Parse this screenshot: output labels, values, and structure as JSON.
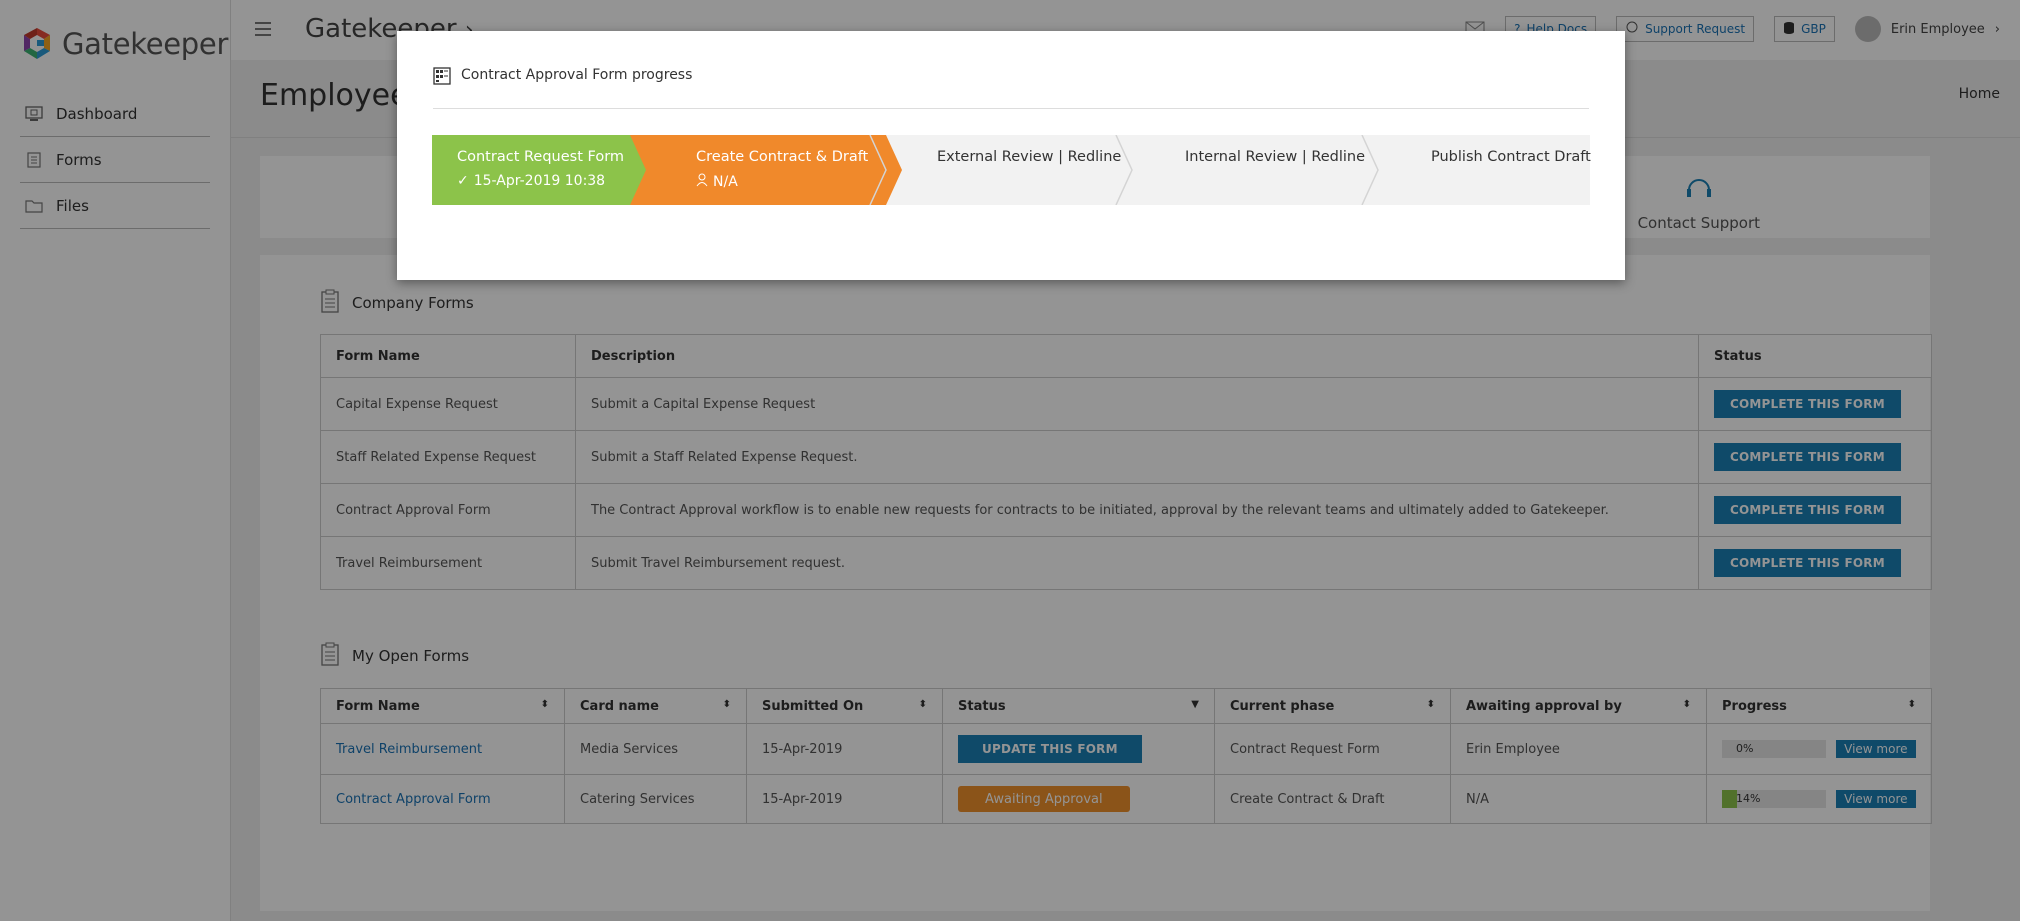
{
  "app": {
    "logo_text": "Gatekeeper",
    "title": "Gatekeeper",
    "title_chevron": "›"
  },
  "sidebar": {
    "items": [
      {
        "label": "Dashboard",
        "icon": "dashboard-icon"
      },
      {
        "label": "Forms",
        "icon": "forms-icon"
      },
      {
        "label": "Files",
        "icon": "folder-icon"
      }
    ]
  },
  "topbar": {
    "help_docs": "Help Docs",
    "support_request": "Support Request",
    "currency": "GBP",
    "user_name": "Erin Employee",
    "user_chevron": "›"
  },
  "page": {
    "title": "Employee",
    "breadcrumb_home": "Home",
    "contact_support": "Contact Support"
  },
  "company_forms": {
    "heading": "Company Forms",
    "columns": [
      "Form Name",
      "Description",
      "Status"
    ],
    "rows": [
      {
        "name": "Capital Expense Request",
        "description": "Submit a Capital Expense Request",
        "action": "COMPLETE THIS FORM"
      },
      {
        "name": "Staff Related Expense Request",
        "description": "Submit a Staff Related Expense Request.",
        "action": "COMPLETE THIS FORM"
      },
      {
        "name": "Contract Approval Form",
        "description": "The Contract Approval workflow is to enable new requests for contracts to be initiated, approval by the relevant teams and ultimately added to Gatekeeper.",
        "action": "COMPLETE THIS FORM"
      },
      {
        "name": "Travel Reimbursement",
        "description": "Submit Travel Reimbursement request.",
        "action": "COMPLETE THIS FORM"
      }
    ]
  },
  "open_forms": {
    "heading": "My Open Forms",
    "columns": [
      "Form Name",
      "Card name",
      "Submitted On",
      "Status",
      "Current phase",
      "Awaiting approval by",
      "Progress"
    ],
    "rows": [
      {
        "name": "Travel Reimbursement",
        "card": "Media Services",
        "submitted": "15-Apr-2019",
        "status": "UPDATE THIS FORM",
        "status_kind": "button",
        "phase": "Contract Request Form",
        "awaiting": "Erin Employee",
        "progress_label": "0%",
        "progress": 0,
        "view_more": "View more"
      },
      {
        "name": "Contract Approval Form",
        "card": "Catering Services",
        "submitted": "15-Apr-2019",
        "status": "Awaiting Approval",
        "status_kind": "badge",
        "phase": "Create Contract & Draft",
        "awaiting": "N/A",
        "progress_label": "14%",
        "progress": 0.14,
        "view_more": "View more"
      }
    ]
  },
  "modal": {
    "title": "Contract Approval Form progress",
    "steps": [
      {
        "label": "Contract Request Form",
        "sub": "15-Apr-2019 10:38",
        "sub_icon": "check-icon",
        "state": "complete",
        "color": "#8cc34a"
      },
      {
        "label": "Create Contract & Draft",
        "sub": "N/A",
        "sub_icon": "user-icon",
        "state": "current",
        "color": "#f0892b"
      },
      {
        "label": "External Review | Redline",
        "state": "pending"
      },
      {
        "label": "Internal Review | Redline",
        "state": "pending"
      },
      {
        "label": "Publish Contract Draft",
        "state": "pending"
      }
    ]
  },
  "colors": {
    "accent_blue": "#1a80b6",
    "complete_green": "#8cc34a",
    "current_orange": "#f0892b"
  }
}
